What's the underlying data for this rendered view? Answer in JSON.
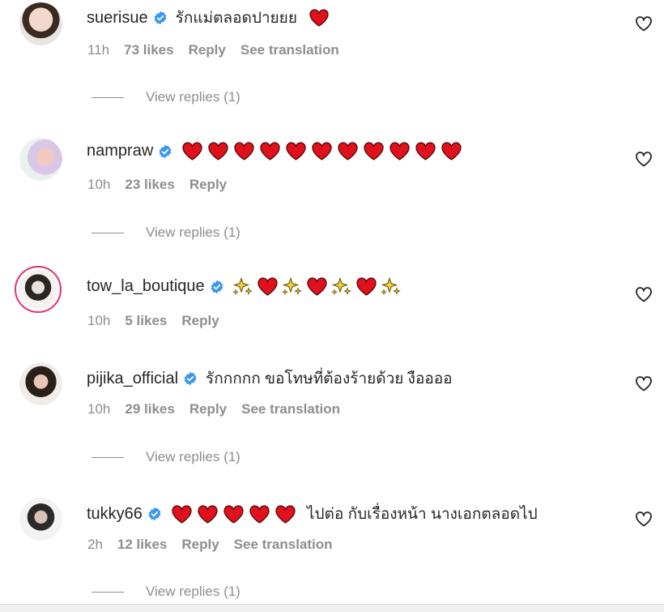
{
  "comments": [
    {
      "username": "suerisue",
      "text": "รักแม่ตลอดปายยย",
      "emoji": [
        "heart"
      ],
      "time": "11h",
      "likes": "73 likes",
      "reply": "Reply",
      "translate": "See translation",
      "view_replies": "View replies (1)"
    },
    {
      "username": "nampraw",
      "text": "",
      "emoji": [
        "heart",
        "heart",
        "heart",
        "heart",
        "heart",
        "heart",
        "heart",
        "heart",
        "heart",
        "heart",
        "heart"
      ],
      "time": "10h",
      "likes": "23 likes",
      "reply": "Reply",
      "translate": "",
      "view_replies": "View replies (1)"
    },
    {
      "username": "tow_la_boutique",
      "text": "",
      "emoji": [
        "sparkles",
        "heart",
        "sparkles",
        "heart",
        "sparkles",
        "heart",
        "sparkles"
      ],
      "time": "10h",
      "likes": "5 likes",
      "reply": "Reply",
      "translate": "",
      "view_replies": ""
    },
    {
      "username": "pijika_official",
      "text": "รักกกกก ขอโทษที่ต้องร้ายด้วย งืออออ",
      "emoji": [],
      "time": "10h",
      "likes": "29 likes",
      "reply": "Reply",
      "translate": "See translation",
      "view_replies": "View replies (1)"
    },
    {
      "username": "tukky66",
      "text": "ไปต่อ กับเรื่องหน้า นางเอกตลอดไป",
      "emoji": [
        "heart",
        "heart",
        "heart",
        "heart",
        "heart"
      ],
      "time": "2h",
      "likes": "12 likes",
      "reply": "Reply",
      "translate": "See translation",
      "view_replies": "View replies (1)"
    }
  ],
  "colors": {
    "verified": "#3897f0",
    "heart": "#e0101c",
    "muted": "#8e8e8e",
    "text": "#262626",
    "sparkle": "#f5d33a"
  },
  "icons": [
    "avatar",
    "verified-badge-icon",
    "heart-emoji",
    "sparkles-emoji",
    "like-heart-outline-icon"
  ]
}
